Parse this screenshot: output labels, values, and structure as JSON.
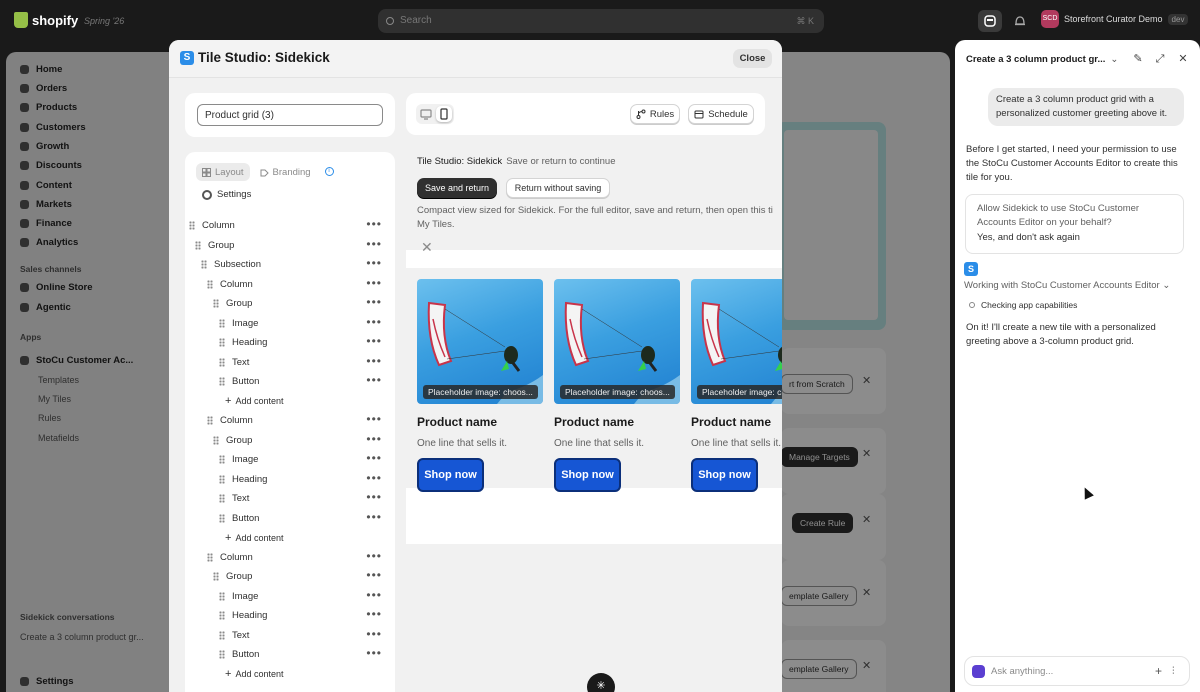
{
  "topbar": {
    "logo": "shopify",
    "edition": "Spring '26",
    "search_placeholder": "Search",
    "search_shortcut": "⌘ K",
    "store_initials": "SCD",
    "store_name": "Storefront Curator Demo",
    "store_badge": "dev"
  },
  "admin_nav": {
    "items": [
      "Home",
      "Orders",
      "Products",
      "Customers",
      "Growth",
      "Discounts",
      "Content",
      "Markets",
      "Finance",
      "Analytics"
    ],
    "sales_channels_header": "Sales channels",
    "sales_channels": [
      "Online Store",
      "Agentic"
    ],
    "apps_header": "Apps",
    "app_name": "StoCu Customer Ac...",
    "app_subitems": [
      "Templates",
      "My Tiles",
      "Rules",
      "Metafields"
    ],
    "sidekick_header": "Sidekick conversations",
    "sidekick_convo": "Create a 3 column product gr...",
    "settings": "Settings"
  },
  "background_buttons": [
    "rt from Scratch",
    "Manage Targets",
    "Create Rule",
    "emplate Gallery",
    "emplate Gallery"
  ],
  "modal": {
    "title": "Tile Studio: Sidekick",
    "close": "Close",
    "tile_name": "Product grid (3)",
    "rules": "Rules",
    "schedule": "Schedule",
    "tab_layout": "Layout",
    "tab_branding": "Branding",
    "settings": "Settings",
    "tree": [
      {
        "label": "Column",
        "indent": 0,
        "more": true
      },
      {
        "label": "Group",
        "indent": 1,
        "more": true
      },
      {
        "label": "Subsection",
        "indent": 2,
        "more": true
      },
      {
        "label": "Column",
        "indent": 3,
        "more": true
      },
      {
        "label": "Group",
        "indent": 4,
        "more": true
      },
      {
        "label": "Image",
        "indent": 5,
        "more": true
      },
      {
        "label": "Heading",
        "indent": 5,
        "more": true
      },
      {
        "label": "Text",
        "indent": 5,
        "more": true
      },
      {
        "label": "Button",
        "indent": 5,
        "more": true
      },
      {
        "label": "Add content",
        "indent": 6,
        "add": true
      },
      {
        "label": "Column",
        "indent": 3,
        "more": true
      },
      {
        "label": "Group",
        "indent": 4,
        "more": true
      },
      {
        "label": "Image",
        "indent": 5,
        "more": true
      },
      {
        "label": "Heading",
        "indent": 5,
        "more": true
      },
      {
        "label": "Text",
        "indent": 5,
        "more": true
      },
      {
        "label": "Button",
        "indent": 5,
        "more": true
      },
      {
        "label": "Add content",
        "indent": 6,
        "add": true
      },
      {
        "label": "Column",
        "indent": 3,
        "more": true
      },
      {
        "label": "Group",
        "indent": 4,
        "more": true
      },
      {
        "label": "Image",
        "indent": 5,
        "more": true
      },
      {
        "label": "Heading",
        "indent": 5,
        "more": true
      },
      {
        "label": "Text",
        "indent": 5,
        "more": true
      },
      {
        "label": "Button",
        "indent": 5,
        "more": true
      },
      {
        "label": "Add content",
        "indent": 6,
        "add": true
      }
    ],
    "preview_title": "Tile Studio: Sidekick",
    "preview_subtitle": "Save or return to continue",
    "save_return": "Save and return",
    "return_without_saving": "Return without saving",
    "description_line1": "Compact view sized for Sidekick. For the full editor, save and return, then open this ti",
    "description_line2": "My Tiles.",
    "products": [
      {
        "placeholder": "Placeholder image: choos...",
        "name": "Product name",
        "line": "One line that sells it.",
        "button": "Shop now"
      },
      {
        "placeholder": "Placeholder image: choos...",
        "name": "Product name",
        "line": "One line that sells it.",
        "button": "Shop now"
      },
      {
        "placeholder": "Placeholder image: ch",
        "name": "Product name",
        "line": "One line that sells it.",
        "button": "Shop now"
      }
    ]
  },
  "sidekick": {
    "title": "Create a 3 column product gr...",
    "user_message": "Create a 3 column product grid with a personalized customer greeting above it.",
    "assistant_message_1": "Before I get started, I need your permission to use the StoCu Customer Accounts Editor to create this tile for you.",
    "permission_question": "Allow Sidekick to use StoCu Customer Accounts Editor on your behalf?",
    "permission_answer": "Yes, and don't ask again",
    "working": "Working with StoCu Customer Accounts Editor",
    "step": "Checking app capabilities",
    "assistant_message_2": "On it! I'll create a new tile with a personalized greeting above a 3-column product grid.",
    "ask_placeholder": "Ask anything..."
  }
}
